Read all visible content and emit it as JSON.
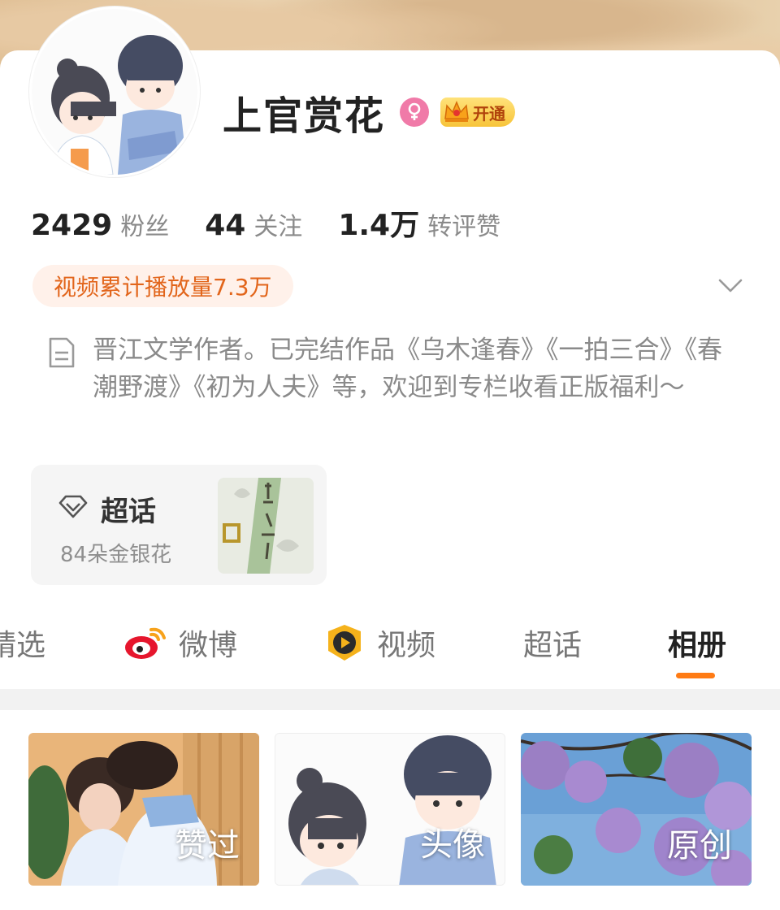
{
  "profile": {
    "name": "上官赏花",
    "vip_label": "开通"
  },
  "stats": [
    {
      "value": "2429",
      "label": "粉丝"
    },
    {
      "value": "44",
      "label": "关注"
    },
    {
      "value": "1.4万",
      "label": "转评赞"
    }
  ],
  "video_badge": "视频累计播放量7.3万",
  "bio": "晋江文学作者。已完结作品《乌木逢春》《一拍三合》《春潮野渡》《初为人夫》等，欢迎到专栏收看正版福利～",
  "super_topic": {
    "title": "超话",
    "subtitle": "84朵金银花"
  },
  "tabs": [
    {
      "label": "精选"
    },
    {
      "label": "微博"
    },
    {
      "label": "视频"
    },
    {
      "label": "超话"
    },
    {
      "label": "相册"
    }
  ],
  "albums": [
    {
      "label": "赞过"
    },
    {
      "label": "头像"
    },
    {
      "label": "原创"
    }
  ],
  "colors": {
    "accent": "#ff7b14",
    "video_badge_text": "#e2651b",
    "video_badge_bg": "#fff1ea",
    "gender": "#f07aa8"
  }
}
